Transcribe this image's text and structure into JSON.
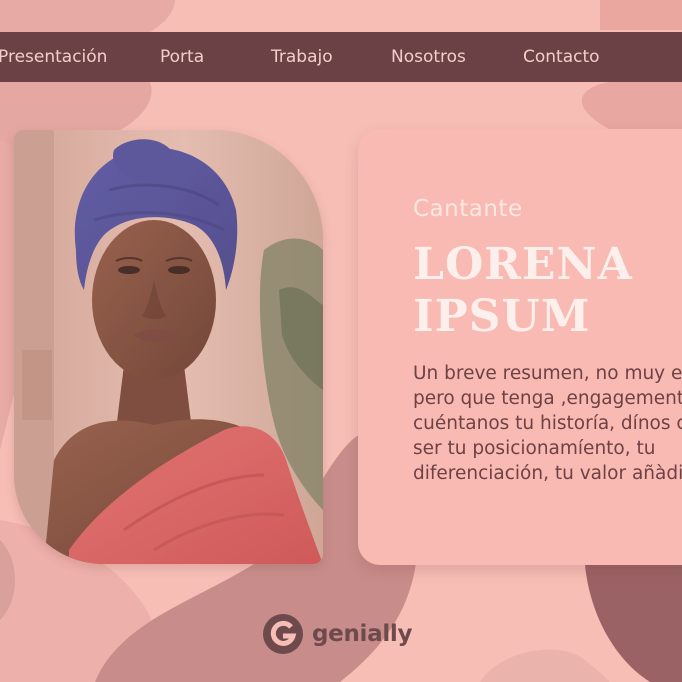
{
  "nav": {
    "items": [
      {
        "label": "Presentación"
      },
      {
        "label": "Porta"
      },
      {
        "label": "Trabajo"
      },
      {
        "label": "Nosotros"
      },
      {
        "label": "Contacto"
      }
    ]
  },
  "profile": {
    "role": "Cantante",
    "name_line1": "LORENA",
    "name_line2": "IPSUM",
    "summary_lines": [
      "Un breve resumen, no muy ext",
      "pero que tenga ,engagements",
      "cuéntanos tu historía, dínos cu",
      "ser tu posicionamíento, tu",
      "diferenciación, tu valor añàdid"
    ],
    "photo_icon": "portrait-photo"
  },
  "branding": {
    "logo_icon": "genially-g-icon",
    "logo_text": "genially"
  },
  "colors": {
    "background": "#f6beb5",
    "nav_background": "#6c4146",
    "nav_text": "#f2cec8",
    "card_background": "#f8bab2",
    "heading_light": "#fdf0ec",
    "body_text": "#6e4146",
    "blob_light": "#e9a8a2",
    "blob_mid": "#c98e8c",
    "blob_dark": "#9d6466"
  }
}
